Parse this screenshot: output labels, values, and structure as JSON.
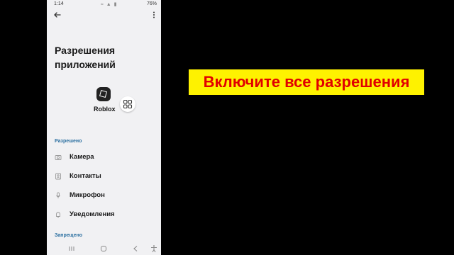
{
  "status_bar": {
    "time": "1:14",
    "icons": "≈ ▲ ▮",
    "battery": "76%"
  },
  "page": {
    "title": "Разрешения приложений"
  },
  "app": {
    "name": "Roblox"
  },
  "sections": {
    "allowed_header": "Разрешено",
    "denied_header": "Запрещено"
  },
  "permissions": [
    {
      "label": "Камера",
      "icon": "camera-icon"
    },
    {
      "label": "Контакты",
      "icon": "contacts-icon"
    },
    {
      "label": "Микрофон",
      "icon": "microphone-icon"
    },
    {
      "label": "Уведомления",
      "icon": "bell-icon"
    }
  ],
  "banner": {
    "text": "Включите все разрешения",
    "background": "#fef200",
    "color": "#e10000"
  }
}
